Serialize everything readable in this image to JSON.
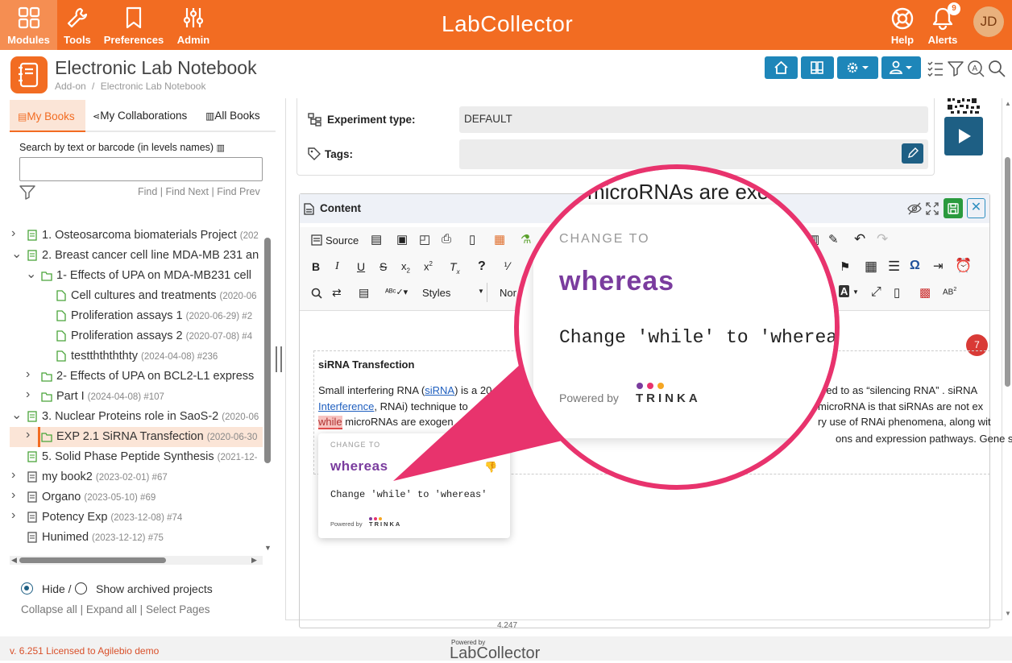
{
  "topbar": {
    "left_items": [
      {
        "label": "Modules",
        "icon": "grid-icon"
      },
      {
        "label": "Tools",
        "icon": "wrench-icon"
      },
      {
        "label": "Preferences",
        "icon": "bookmark-icon"
      },
      {
        "label": "Admin",
        "icon": "sliders-icon"
      }
    ],
    "logo": "LabCollector",
    "right_items": [
      {
        "label": "Help",
        "icon": "lifebuoy-icon"
      },
      {
        "label": "Alerts",
        "icon": "bell-icon",
        "badge": "9"
      }
    ],
    "avatar": "JD",
    "accent_color": "#f26c22"
  },
  "header": {
    "title": "Electronic Lab Notebook",
    "breadcrumb": [
      "Add-on",
      "/",
      "Electronic Lab Notebook"
    ]
  },
  "left_panel": {
    "tabs": [
      "My Books",
      "My Collaborations",
      "All Books"
    ],
    "search_label": "Search by text or barcode (in levels names)",
    "search_value": "",
    "find_links": [
      "Find",
      "Find Next",
      "Find Prev"
    ],
    "tree": [
      {
        "name": "1. Osteosarcoma biomaterials Project",
        "meta": "(202",
        "expanded": false
      },
      {
        "name": "2. Breast cancer cell line MDA-MB 231 an",
        "meta": "",
        "expanded": true
      },
      {
        "name": "1- Effects of UPA on MDA-MB231 cell",
        "meta": "",
        "expanded": true
      },
      {
        "name": "Cell cultures and treatments",
        "meta": "(2020-06"
      },
      {
        "name": "Proliferation assays 1",
        "meta": "(2020-06-29) #2"
      },
      {
        "name": "Proliferation assays 2",
        "meta": "(2020-07-08) #4"
      },
      {
        "name": "testththththty",
        "meta": "(2024-04-08) #236"
      },
      {
        "name": "2- Effects of UPA on BCL2-L1 express",
        "meta": "",
        "expanded": false
      },
      {
        "name": "Part I",
        "meta": "(2024-04-08) #107",
        "expanded": false
      },
      {
        "name": "3. Nuclear Proteins role in SaoS-2",
        "meta": "(2020-06",
        "expanded": true
      },
      {
        "name": "EXP 2.1 SiRNA Transfection",
        "meta": "(2020-06-30",
        "expanded": false,
        "selected": true
      },
      {
        "name": "5. Solid Phase Peptide Synthesis",
        "meta": "(2021-12-"
      },
      {
        "name": "my book2",
        "meta": "(2023-02-01) #67",
        "expanded": false
      },
      {
        "name": "Organo",
        "meta": "(2023-05-10) #69",
        "expanded": false
      },
      {
        "name": "Potency Exp",
        "meta": "(2023-12-08) #74",
        "expanded": false
      },
      {
        "name": "Hunimed",
        "meta": "(2023-12-12) #75"
      }
    ],
    "archived_hide": "Hide /",
    "archived_show": "Show archived projects",
    "bottom_links": [
      "Collapse all",
      "|",
      "Expand all",
      "|",
      "Select Pages"
    ]
  },
  "meta": {
    "experiment_type_label": "Experiment type:",
    "experiment_type_value": "DEFAULT",
    "tags_label": "Tags:",
    "tags_value": ""
  },
  "content": {
    "title": "Content",
    "toolbar": {
      "source": "Source",
      "styles": "Styles",
      "normal": "Nor"
    },
    "heading": "siRNA Transfection",
    "line1_start": "Small interfering RNA (",
    "line1_link": "siRNA",
    "line1_mid": ") is a 20",
    "line1_end": "red to as “silencing RNA” . siRNA",
    "line2_link": "Interference",
    "line2_mid": ", RNAi) technique to",
    "line2_end": "microRNA is that siRNAs are not ex",
    "line3_flag": "while",
    "line3_mid": " microRNAs are exogen",
    "line3_end": "ry use of RNAi phenomena, along wit",
    "line4_end": "ons and expression pathways. Gene sile",
    "issues_count": "7"
  },
  "suggestion": {
    "label": "CHANGE TO",
    "word": "whereas",
    "detail": "Change 'while' to 'whereas'",
    "powered": "Powered by",
    "brand": "TRINKA"
  },
  "magnifier": {
    "snippet": "microRNAs are exo"
  },
  "footer": {
    "license": "v. 6.251 Licensed to Agilebio demo",
    "build": "4.247",
    "powered": "Powered by",
    "logo": "LabCollector"
  }
}
